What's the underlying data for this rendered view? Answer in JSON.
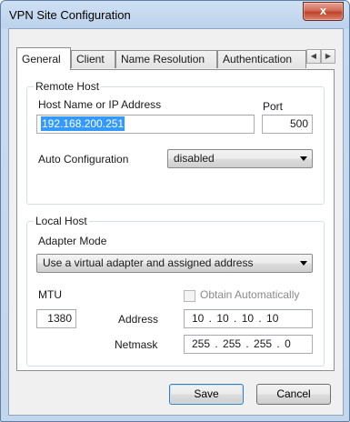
{
  "window": {
    "title": "VPN Site Configuration",
    "close_glyph": "x"
  },
  "tabs": [
    {
      "label": "General",
      "active": true
    },
    {
      "label": "Client"
    },
    {
      "label": "Name Resolution"
    },
    {
      "label": "Authentication"
    }
  ],
  "tab_scroll": {
    "left_glyph": "◀",
    "right_glyph": "▶"
  },
  "remote_host": {
    "group_label": "Remote Host",
    "host_label": "Host Name or IP Address",
    "host_value": "192.168.200.251",
    "port_label": "Port",
    "port_value": "500",
    "auto_config_label": "Auto Configuration",
    "auto_config_value": "disabled"
  },
  "local_host": {
    "group_label": "Local Host",
    "adapter_mode_label": "Adapter Mode",
    "adapter_mode_value": "Use a virtual adapter and assigned address",
    "mtu_label": "MTU",
    "mtu_value": "1380",
    "obtain_auto_label": "Obtain Automatically",
    "address_label": "Address",
    "address_value": "10 . 10 . 10 . 10",
    "netmask_label": "Netmask",
    "netmask_value": "255 . 255 . 255 . 0"
  },
  "buttons": {
    "save": "Save",
    "cancel": "Cancel"
  }
}
